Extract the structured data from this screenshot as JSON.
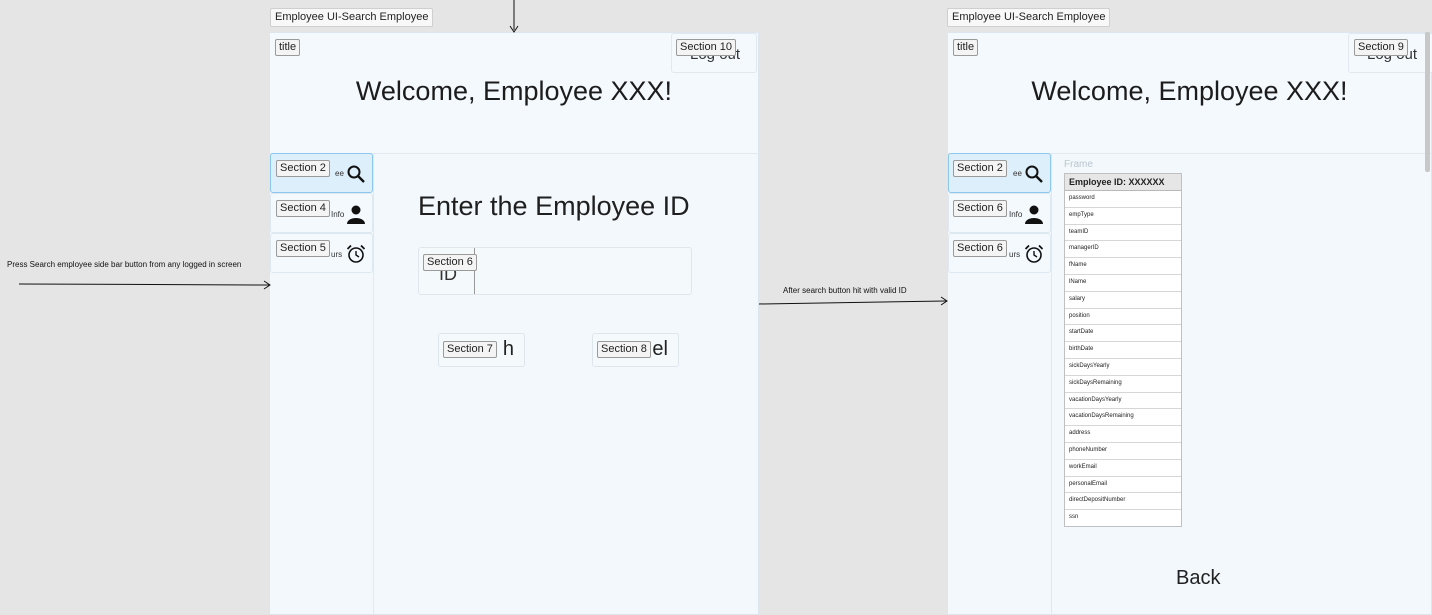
{
  "frames": {
    "left_title": "Employee UI-Search Employee",
    "right_title": "Employee UI-Search Employee"
  },
  "left_screen": {
    "title_tag": "title",
    "welcome": "Welcome, Employee XXX!",
    "logout_partial": "Log out",
    "section_logout": "Section 10",
    "sidebar": [
      {
        "section": "Section 2",
        "label_partial": "ee",
        "icon": "search-icon"
      },
      {
        "section": "Section 4",
        "label_partial": "l Info",
        "icon": "person-icon"
      },
      {
        "section": "Section 5",
        "label_partial": "urs",
        "icon": "alarm-clock-icon"
      }
    ],
    "heading": "Enter the Employee ID",
    "input": {
      "section": "Section 6",
      "label_partial": "ID"
    },
    "search_button": {
      "section": "Section 7",
      "label_partial": "h"
    },
    "cancel_button": {
      "section": "Section 8",
      "label_partial": "el"
    }
  },
  "right_screen": {
    "title_tag": "title",
    "welcome": "Welcome, Employee XXX!",
    "logout_partial": "Log out",
    "section_logout": "Section 9",
    "sidebar": [
      {
        "section": "Section 2",
        "label_partial": "ee",
        "icon": "search-icon"
      },
      {
        "section": "Section 6",
        "label_partial": "l Info",
        "icon": "person-icon"
      },
      {
        "section": "Section 6",
        "label_partial": "urs",
        "icon": "alarm-clock-icon"
      }
    ],
    "frame_caption": "Frame",
    "table": {
      "header": "Employee ID: XXXXXX",
      "fields": [
        "password",
        "empType",
        "teamID",
        "managerID",
        "fName",
        "lName",
        "salary",
        "position",
        "startDate",
        "birthDate",
        "sickDaysYearly",
        "sickDaysRemaining",
        "vacationDaysYearly",
        "vacationDaysRemaining",
        "address",
        "phoneNumber",
        "workEmail",
        "personalEmail",
        "directDepositNumber",
        "ssn"
      ]
    },
    "back_label": "Back"
  },
  "annotations": {
    "left_note": "Press Search employee side bar button from any logged in screen",
    "middle_note": "After search button hit with valid ID"
  },
  "colors": {
    "screen_bg": "#f2f8fc",
    "active_side_bg": "#dceffb",
    "active_side_border": "#8cc7ef",
    "canvas_bg": "#e5e5e5"
  }
}
